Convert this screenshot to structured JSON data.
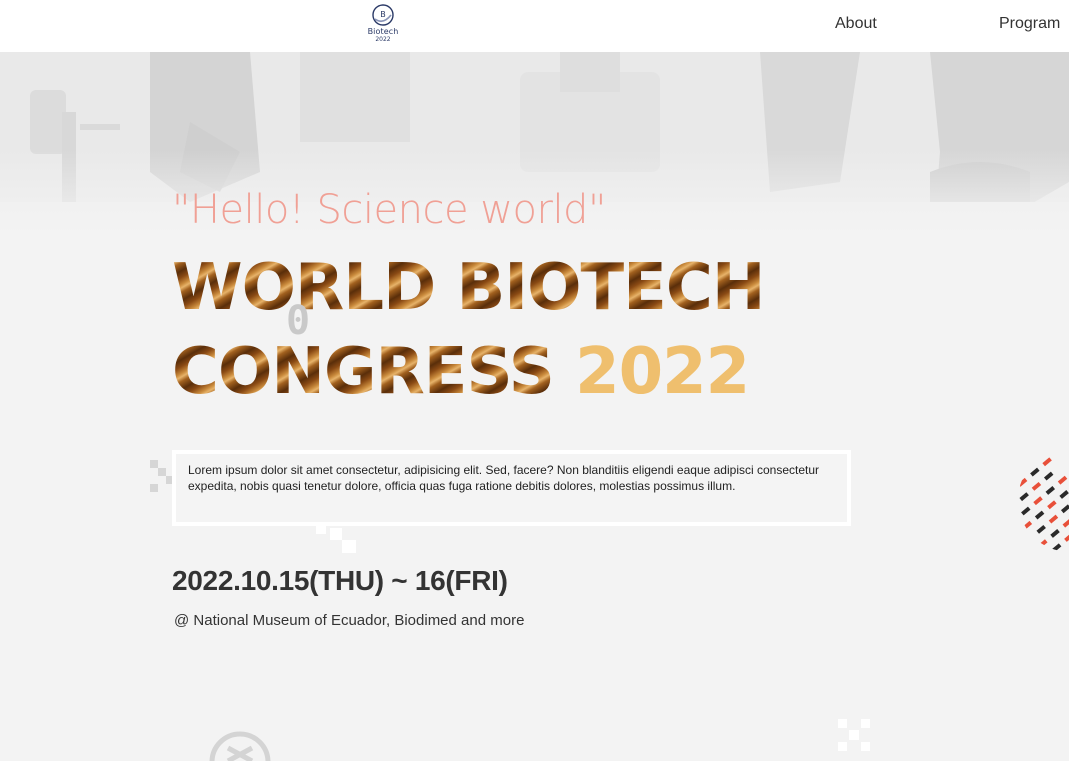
{
  "header": {
    "logo": {
      "name": "Biotech",
      "year": "2022",
      "icon": "biotech-logo-icon"
    },
    "nav": [
      {
        "label": "About"
      },
      {
        "label": "Program"
      }
    ]
  },
  "hero": {
    "tagline": "\"Hello! Science world\"",
    "title_line1": "WORLD BIOTECH",
    "title_line2_a": "CONGRESS",
    "title_line2_b": "2022",
    "ghost_glyph": "0",
    "description": "Lorem ipsum dolor sit amet consectetur, adipisicing elit. Sed, facere? Non blanditiis eligendi eaque adipisci consectetur expedita, nobis quasi tenetur dolore, officia quas fuga ratione debitis dolores, molestias possimus illum.",
    "dates": "2022.10.15(THU) ~ 16(FRI)",
    "venue": "@ National Museum of Ecuador, Biodimed and more"
  },
  "colors": {
    "tagline": "#f0a095",
    "title_stripes_dark": "#5a2e0a",
    "title_stripes_light": "#e7b36a",
    "year": "#efbf6e",
    "accent_red": "#e8503a",
    "dark_dash": "#2a2a2a"
  }
}
